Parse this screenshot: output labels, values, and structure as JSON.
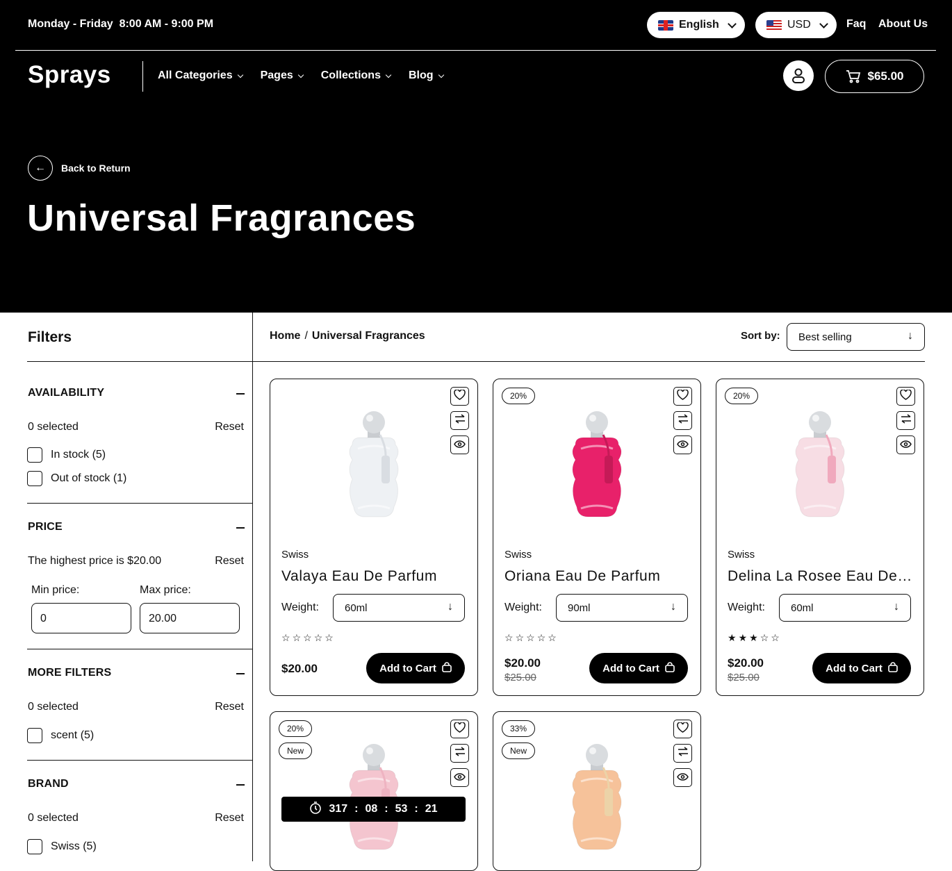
{
  "topbar": {
    "hours": "Monday - Friday  8:00 AM - 9:00 PM",
    "language": "English",
    "currency": "USD",
    "faq": "Faq",
    "about": "About Us"
  },
  "header": {
    "logo": "Sprays",
    "nav": [
      "All Categories",
      "Pages",
      "Collections",
      "Blog"
    ],
    "cart_total": "$65.00"
  },
  "hero": {
    "back_label": "Back to Return",
    "title": "Universal Fragrances"
  },
  "sidebar": {
    "title": "Filters",
    "availability": {
      "title": "AVAILABILITY",
      "selected": "0 selected",
      "reset": "Reset",
      "options": [
        "In stock (5)",
        "Out of stock (1)"
      ]
    },
    "price": {
      "title": "PRICE",
      "note": "The highest price is $20.00",
      "reset": "Reset",
      "min_label": "Min price:",
      "max_label": "Max price:",
      "min_value": "0",
      "max_value": "20.00"
    },
    "more_filters": {
      "title": "MORE FILTERS",
      "selected": "0 selected",
      "reset": "Reset",
      "options": [
        "scent (5)"
      ]
    },
    "brand": {
      "title": "BRAND",
      "selected": "0 selected",
      "reset": "Reset",
      "options": [
        "Swiss (5)"
      ]
    }
  },
  "main": {
    "breadcrumb": [
      "Home",
      "Universal Fragrances"
    ],
    "sort_label": "Sort by:",
    "sort_value": "Best selling",
    "weight_label": "Weight:",
    "add_to_cart": "Add to Cart",
    "products": [
      {
        "brand": "Swiss",
        "name": "Valaya Eau De Parfum",
        "weight": "60ml",
        "rating": 0,
        "price": "$20.00",
        "old_price": "",
        "badges": [],
        "bottle_color": "#eef1f4",
        "tassel_color": "#d9dde2"
      },
      {
        "brand": "Swiss",
        "name": "Oriana Eau De Parfum",
        "weight": "90ml",
        "rating": 0,
        "price": "$20.00",
        "old_price": "$25.00",
        "badges": [
          "20%"
        ],
        "bottle_color": "#e8216a",
        "tassel_color": "#c51a57"
      },
      {
        "brand": "Swiss",
        "name": "Delina La Rosee Eau De Parfum",
        "weight": "60ml",
        "rating": 3,
        "price": "$20.00",
        "old_price": "$25.00",
        "badges": [
          "20%"
        ],
        "bottle_color": "#f7dde4",
        "tassel_color": "#f0a9bd"
      },
      {
        "badges": [
          "20%",
          "New"
        ],
        "countdown": [
          "317",
          "08",
          "53",
          "21"
        ],
        "bottle_color": "#f4c5cf",
        "tassel_color": "#eeb3c1"
      },
      {
        "badges": [
          "33%",
          "New"
        ],
        "bottle_color": "#f6c29a",
        "tassel_color": "#ecd3a8"
      }
    ]
  }
}
